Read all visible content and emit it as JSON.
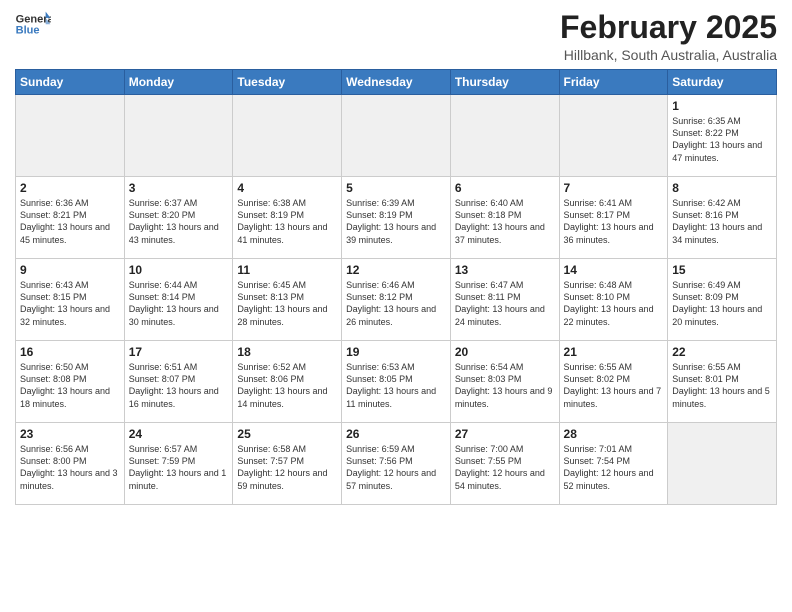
{
  "header": {
    "logo_line1": "General",
    "logo_line2": "Blue",
    "month_title": "February 2025",
    "location": "Hillbank, South Australia, Australia"
  },
  "weekdays": [
    "Sunday",
    "Monday",
    "Tuesday",
    "Wednesday",
    "Thursday",
    "Friday",
    "Saturday"
  ],
  "weeks": [
    [
      {
        "day": "",
        "info": ""
      },
      {
        "day": "",
        "info": ""
      },
      {
        "day": "",
        "info": ""
      },
      {
        "day": "",
        "info": ""
      },
      {
        "day": "",
        "info": ""
      },
      {
        "day": "",
        "info": ""
      },
      {
        "day": "1",
        "info": "Sunrise: 6:35 AM\nSunset: 8:22 PM\nDaylight: 13 hours\nand 47 minutes."
      }
    ],
    [
      {
        "day": "2",
        "info": "Sunrise: 6:36 AM\nSunset: 8:21 PM\nDaylight: 13 hours\nand 45 minutes."
      },
      {
        "day": "3",
        "info": "Sunrise: 6:37 AM\nSunset: 8:20 PM\nDaylight: 13 hours\nand 43 minutes."
      },
      {
        "day": "4",
        "info": "Sunrise: 6:38 AM\nSunset: 8:19 PM\nDaylight: 13 hours\nand 41 minutes."
      },
      {
        "day": "5",
        "info": "Sunrise: 6:39 AM\nSunset: 8:19 PM\nDaylight: 13 hours\nand 39 minutes."
      },
      {
        "day": "6",
        "info": "Sunrise: 6:40 AM\nSunset: 8:18 PM\nDaylight: 13 hours\nand 37 minutes."
      },
      {
        "day": "7",
        "info": "Sunrise: 6:41 AM\nSunset: 8:17 PM\nDaylight: 13 hours\nand 36 minutes."
      },
      {
        "day": "8",
        "info": "Sunrise: 6:42 AM\nSunset: 8:16 PM\nDaylight: 13 hours\nand 34 minutes."
      }
    ],
    [
      {
        "day": "9",
        "info": "Sunrise: 6:43 AM\nSunset: 8:15 PM\nDaylight: 13 hours\nand 32 minutes."
      },
      {
        "day": "10",
        "info": "Sunrise: 6:44 AM\nSunset: 8:14 PM\nDaylight: 13 hours\nand 30 minutes."
      },
      {
        "day": "11",
        "info": "Sunrise: 6:45 AM\nSunset: 8:13 PM\nDaylight: 13 hours\nand 28 minutes."
      },
      {
        "day": "12",
        "info": "Sunrise: 6:46 AM\nSunset: 8:12 PM\nDaylight: 13 hours\nand 26 minutes."
      },
      {
        "day": "13",
        "info": "Sunrise: 6:47 AM\nSunset: 8:11 PM\nDaylight: 13 hours\nand 24 minutes."
      },
      {
        "day": "14",
        "info": "Sunrise: 6:48 AM\nSunset: 8:10 PM\nDaylight: 13 hours\nand 22 minutes."
      },
      {
        "day": "15",
        "info": "Sunrise: 6:49 AM\nSunset: 8:09 PM\nDaylight: 13 hours\nand 20 minutes."
      }
    ],
    [
      {
        "day": "16",
        "info": "Sunrise: 6:50 AM\nSunset: 8:08 PM\nDaylight: 13 hours\nand 18 minutes."
      },
      {
        "day": "17",
        "info": "Sunrise: 6:51 AM\nSunset: 8:07 PM\nDaylight: 13 hours\nand 16 minutes."
      },
      {
        "day": "18",
        "info": "Sunrise: 6:52 AM\nSunset: 8:06 PM\nDaylight: 13 hours\nand 14 minutes."
      },
      {
        "day": "19",
        "info": "Sunrise: 6:53 AM\nSunset: 8:05 PM\nDaylight: 13 hours\nand 11 minutes."
      },
      {
        "day": "20",
        "info": "Sunrise: 6:54 AM\nSunset: 8:03 PM\nDaylight: 13 hours\nand 9 minutes."
      },
      {
        "day": "21",
        "info": "Sunrise: 6:55 AM\nSunset: 8:02 PM\nDaylight: 13 hours\nand 7 minutes."
      },
      {
        "day": "22",
        "info": "Sunrise: 6:55 AM\nSunset: 8:01 PM\nDaylight: 13 hours\nand 5 minutes."
      }
    ],
    [
      {
        "day": "23",
        "info": "Sunrise: 6:56 AM\nSunset: 8:00 PM\nDaylight: 13 hours\nand 3 minutes."
      },
      {
        "day": "24",
        "info": "Sunrise: 6:57 AM\nSunset: 7:59 PM\nDaylight: 13 hours\nand 1 minute."
      },
      {
        "day": "25",
        "info": "Sunrise: 6:58 AM\nSunset: 7:57 PM\nDaylight: 12 hours\nand 59 minutes."
      },
      {
        "day": "26",
        "info": "Sunrise: 6:59 AM\nSunset: 7:56 PM\nDaylight: 12 hours\nand 57 minutes."
      },
      {
        "day": "27",
        "info": "Sunrise: 7:00 AM\nSunset: 7:55 PM\nDaylight: 12 hours\nand 54 minutes."
      },
      {
        "day": "28",
        "info": "Sunrise: 7:01 AM\nSunset: 7:54 PM\nDaylight: 12 hours\nand 52 minutes."
      },
      {
        "day": "",
        "info": ""
      }
    ]
  ]
}
